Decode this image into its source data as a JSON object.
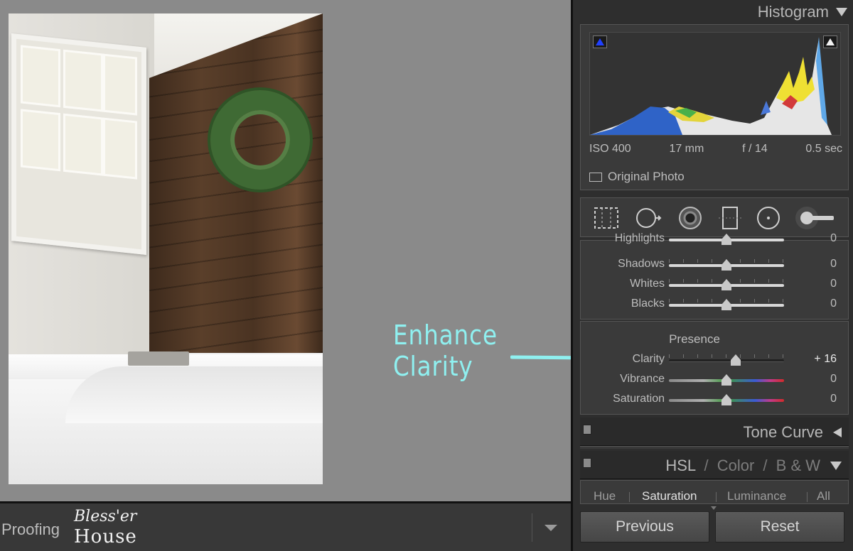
{
  "canvas": {
    "annotation": "Enhance Clarity"
  },
  "bottom_bar": {
    "mode_label": "Proofing",
    "logo_top": "Bless'er",
    "logo_bottom": "House"
  },
  "histogram": {
    "title": "Histogram",
    "iso": "ISO 400",
    "focal": "17 mm",
    "aperture": "f / 14",
    "shutter": "0.5 sec",
    "original_photo": "Original Photo"
  },
  "tools": [
    "crop-tool",
    "spot-removal-tool",
    "red-eye-tool",
    "graduated-filter-tool",
    "radial-filter-tool",
    "adjustment-brush-tool"
  ],
  "basic": {
    "rows": [
      {
        "label": "Highlights",
        "value": "0",
        "pos": 0.5
      },
      {
        "label": "Shadows",
        "value": "0",
        "pos": 0.5
      },
      {
        "label": "Whites",
        "value": "0",
        "pos": 0.5
      },
      {
        "label": "Blacks",
        "value": "0",
        "pos": 0.5
      }
    ]
  },
  "presence": {
    "title": "Presence",
    "rows": [
      {
        "label": "Clarity",
        "value": "+ 16",
        "pos": 0.58
      },
      {
        "label": "Vibrance",
        "value": "0",
        "pos": 0.5
      },
      {
        "label": "Saturation",
        "value": "0",
        "pos": 0.5
      }
    ]
  },
  "tone_curve": {
    "title": "Tone Curve"
  },
  "hsl": {
    "hsl_label": "HSL",
    "color_label": "Color",
    "bw_label": "B & W",
    "tabs": [
      "Hue",
      "Saturation",
      "Luminance",
      "All"
    ],
    "active_tab": "Saturation"
  },
  "buttons": {
    "previous": "Previous",
    "reset": "Reset"
  },
  "colors": {
    "annotation": "#8ff0f0",
    "panel_bg": "#2e2e2e",
    "canvas_bg": "#8a8a8a"
  }
}
